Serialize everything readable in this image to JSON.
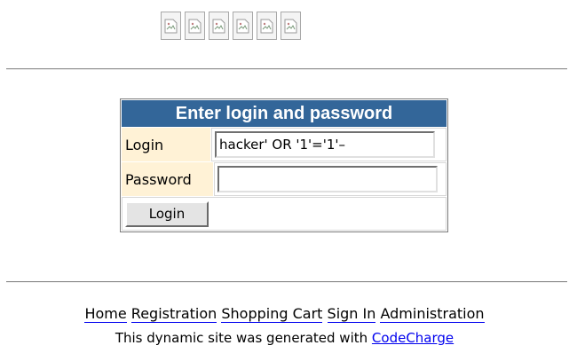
{
  "header_images": [
    {
      "icon": "broken-image-icon"
    },
    {
      "icon": "broken-image-icon"
    },
    {
      "icon": "broken-image-icon"
    },
    {
      "icon": "broken-image-icon"
    },
    {
      "icon": "broken-image-icon"
    },
    {
      "icon": "broken-image-icon"
    }
  ],
  "login_form": {
    "title": "Enter login and password",
    "login_label": "Login",
    "login_value": "hacker' OR '1'='1'–",
    "password_label": "Password",
    "password_value": "",
    "submit_label": "Login"
  },
  "footer": {
    "nav": {
      "home": "Home",
      "registration": "Registration",
      "shopping_cart": "Shopping Cart",
      "sign_in": "Sign In",
      "administration": "Administration"
    },
    "credit_text": "This dynamic site was generated with",
    "credit_link": "CodeCharge"
  },
  "colors": {
    "header_bg": "#336699",
    "label_bg": "#fff2d6",
    "link": "#0000ee"
  }
}
